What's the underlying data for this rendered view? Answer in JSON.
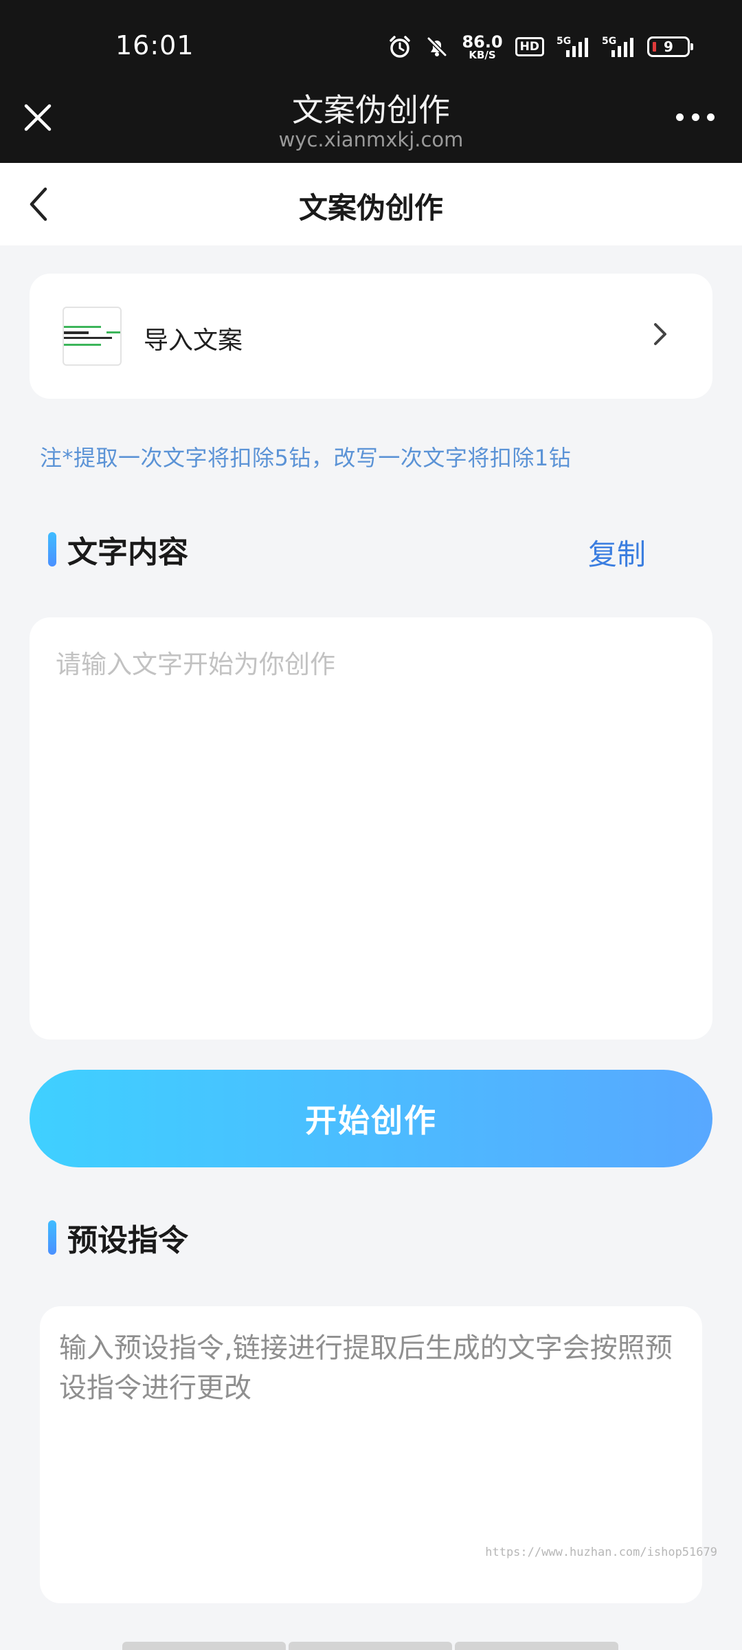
{
  "status_bar": {
    "time": "16:01",
    "net_speed_value": "86.0",
    "net_speed_unit": "KB/S",
    "hd_label": "HD",
    "signal_label_1": "5G",
    "signal_label_2": "5G",
    "battery_level": "9"
  },
  "browser_header": {
    "title": "文案伪创作",
    "url": "wyc.xianmxkj.com"
  },
  "nav": {
    "title": "文案伪创作"
  },
  "import": {
    "label": "导入文案"
  },
  "notice": "注*提取一次文字将扣除5钻，改写一次文字将扣除1钻",
  "text_section": {
    "title": "文字内容",
    "copy_label": "复制",
    "placeholder": "请输入文字开始为你创作"
  },
  "start_button": {
    "label": "开始创作"
  },
  "preset_section": {
    "title": "预设指令",
    "placeholder": "输入预设指令,链接进行提取后生成的文字会按照预设指令进行更改"
  },
  "watermark": "https://www.huzhan.com/ishop51679",
  "colors": {
    "accent": "#3b7ee0",
    "notice": "#5b93d6",
    "button_start": "#3fd0ff",
    "button_end": "#58a8ff",
    "background": "#f4f5f7"
  }
}
